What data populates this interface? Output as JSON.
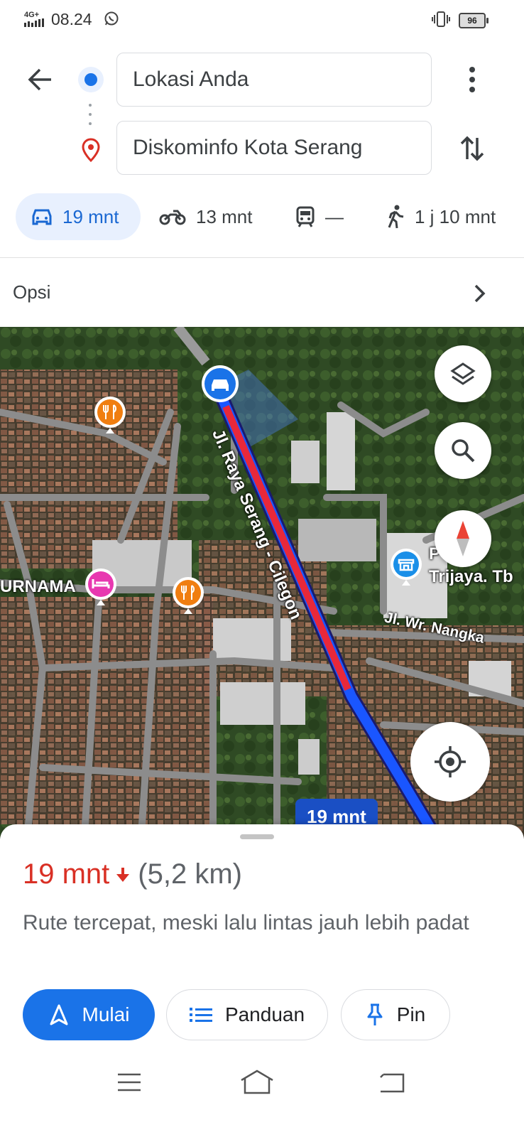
{
  "status_bar": {
    "network": "4G+",
    "time": "08.24",
    "battery": "96"
  },
  "route": {
    "origin": "Lokasi Anda",
    "destination": "Diskominfo Kota Serang"
  },
  "modes": [
    {
      "icon": "car-icon",
      "label": "19 mnt",
      "selected": true
    },
    {
      "icon": "motorcycle-icon",
      "label": "13 mnt",
      "selected": false
    },
    {
      "icon": "transit-icon",
      "label": "—",
      "selected": false
    },
    {
      "icon": "walk-icon",
      "label": "1 j 10 mnt",
      "selected": false
    }
  ],
  "options_label": "Opsi",
  "map": {
    "road_main": "Jl. Raya Serang - Cilegon",
    "road_side": "Jl. Wr. Nangka",
    "place_left": "URNAMA",
    "place_right_1": "P    amb",
    "place_right_2": "Trijaya. Tb",
    "eta_chip": "19 mnt",
    "colors": {
      "route": "#1a56ff",
      "traffic": "#e8283a"
    }
  },
  "summary": {
    "duration": "19 mnt",
    "distance": "(5,2 km)",
    "description": "Rute tercepat, meski lalu lintas jauh lebih padat"
  },
  "actions": {
    "start": "Mulai",
    "guide": "Panduan",
    "pin": "Pin"
  }
}
